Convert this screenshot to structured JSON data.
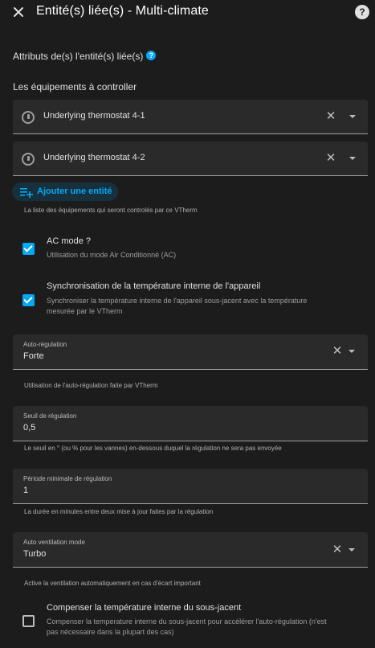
{
  "header": {
    "title": "Entité(s) liée(s) - Multi-climate",
    "help_glyph": "?"
  },
  "section": {
    "attributes_label": "Attributs de(s) l'entité(s) liée(s)",
    "info_glyph": "?",
    "equipment_heading": "Les équipements à controller"
  },
  "entities": [
    {
      "label": "Underlying thermostat 4-1",
      "icon": "thermostat-icon"
    },
    {
      "label": "Underlying thermostat 4-2",
      "icon": "thermostat-icon"
    }
  ],
  "add_entity": {
    "label": "Ajouter une entité",
    "icon": "playlist-plus-icon"
  },
  "entities_helper": "La liste des équipements qui seront controlés par ce VTherm",
  "ac_mode": {
    "checked": true,
    "title": "AC mode ?",
    "description": "Utilisation du mode Air Conditionné (AC)"
  },
  "sync_temp": {
    "checked": true,
    "title": "Synchronisation de la température interne de l'appareil",
    "description_line1": "Synchroniser la température interne de l'appareil sous-jacent avec la température",
    "description_line2": "mesurée par le VTherm"
  },
  "auto_regulation": {
    "label": "Auto-régulation",
    "value": "Forte",
    "helper": "Utilisation de l'auto-régulation faite par VTherm"
  },
  "regulation_threshold": {
    "label": "Seuil de régulation",
    "value": "0,5",
    "helper": "Le seuil en ° (ou % pour les vannes) en-dessous duquel la régulation ne sera pas envoyée"
  },
  "min_period": {
    "label": "Période minimale de régulation",
    "value": "1",
    "helper": "La durée en minutes entre deux mise à jour faites par la régulation"
  },
  "auto_fan": {
    "label": "Auto ventilation mode",
    "value": "Turbo",
    "helper": "Active la ventilation automatiquement en cas d'écart important"
  },
  "compensate": {
    "checked": false,
    "title": "Compenser la température interne du sous-jacent",
    "description_line1": "Compenser la temperature interne du sous-jacent pour accélérer l'auto-régulation (n'est",
    "description_line2": "pas nécessaire dans la plupart des cas)"
  },
  "colors": {
    "background": "#1c1c1c",
    "field": "#2a2a2a",
    "accent": "#03a9f4",
    "text": "#e1e1e1",
    "secondary_text": "#9e9e9e"
  }
}
